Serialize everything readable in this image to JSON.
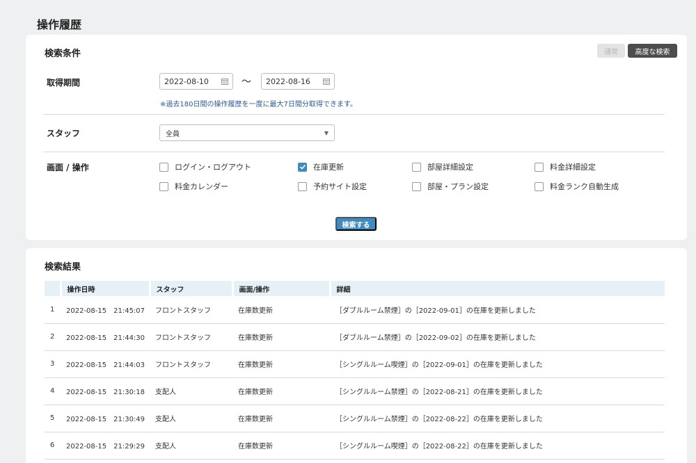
{
  "page": {
    "title": "操作履歴"
  },
  "search": {
    "title": "検索条件",
    "mode_normal": "通常",
    "mode_advanced": "高度な検索",
    "period": {
      "label": "取得期間",
      "from": "2022-08-10",
      "to": "2022-08-16",
      "separator": "〜",
      "note": "※過去180日間の操作履歴を一度に最大7日間分取得できます。"
    },
    "staff": {
      "label": "スタッフ",
      "selected": "全員"
    },
    "screen": {
      "label": "画面 / 操作",
      "options": [
        {
          "label": "ログイン・ログアウト",
          "checked": false
        },
        {
          "label": "在庫更新",
          "checked": true
        },
        {
          "label": "部屋詳細設定",
          "checked": false
        },
        {
          "label": "料金詳細設定",
          "checked": false
        },
        {
          "label": "料金カレンダー",
          "checked": false
        },
        {
          "label": "予約サイト設定",
          "checked": false
        },
        {
          "label": "部屋・プラン設定",
          "checked": false
        },
        {
          "label": "料金ランク自動生成",
          "checked": false
        }
      ]
    },
    "submit": "検索する"
  },
  "results": {
    "title": "検索結果",
    "columns": [
      "",
      "操作日時",
      "スタッフ",
      "画面/操作",
      "詳細"
    ],
    "rows": [
      {
        "no": "1",
        "datetime": "2022-08-15　21:45:07",
        "staff": "フロントスタッフ",
        "screen": "在庫数更新",
        "detail": "［ダブルルーム禁煙］の［2022-09-01］の在庫を更新しました"
      },
      {
        "no": "2",
        "datetime": "2022-08-15　21:44:30",
        "staff": "フロントスタッフ",
        "screen": "在庫数更新",
        "detail": "［ダブルルーム禁煙］の［2022-09-02］の在庫を更新しました"
      },
      {
        "no": "3",
        "datetime": "2022-08-15　21:44:03",
        "staff": "フロントスタッフ",
        "screen": "在庫数更新",
        "detail": "［シングルルーム喫煙］の［2022-09-01］の在庫を更新しました"
      },
      {
        "no": "4",
        "datetime": "2022-08-15　21:30:18",
        "staff": "支配人",
        "screen": "在庫数更新",
        "detail": "［シングルルーム禁煙］の［2022-08-21］の在庫を更新しました"
      },
      {
        "no": "5",
        "datetime": "2022-08-15　21:30:49",
        "staff": "支配人",
        "screen": "在庫数更新",
        "detail": "［シングルルーム禁煙］の［2022-08-22］の在庫を更新しました"
      },
      {
        "no": "6",
        "datetime": "2022-08-15　21:29:29",
        "staff": "支配人",
        "screen": "在庫数更新",
        "detail": "［シングルルーム喫煙］の［2022-08-22］の在庫を更新しました"
      }
    ]
  },
  "icons": {
    "calendar": "calendar-icon",
    "check": "check-icon",
    "caret": "caret-down-icon"
  },
  "colors": {
    "accent": "#3d8bc0",
    "link": "#2b7ac0",
    "note": "#2c5b9c",
    "header_bg": "#e6f0f7"
  }
}
